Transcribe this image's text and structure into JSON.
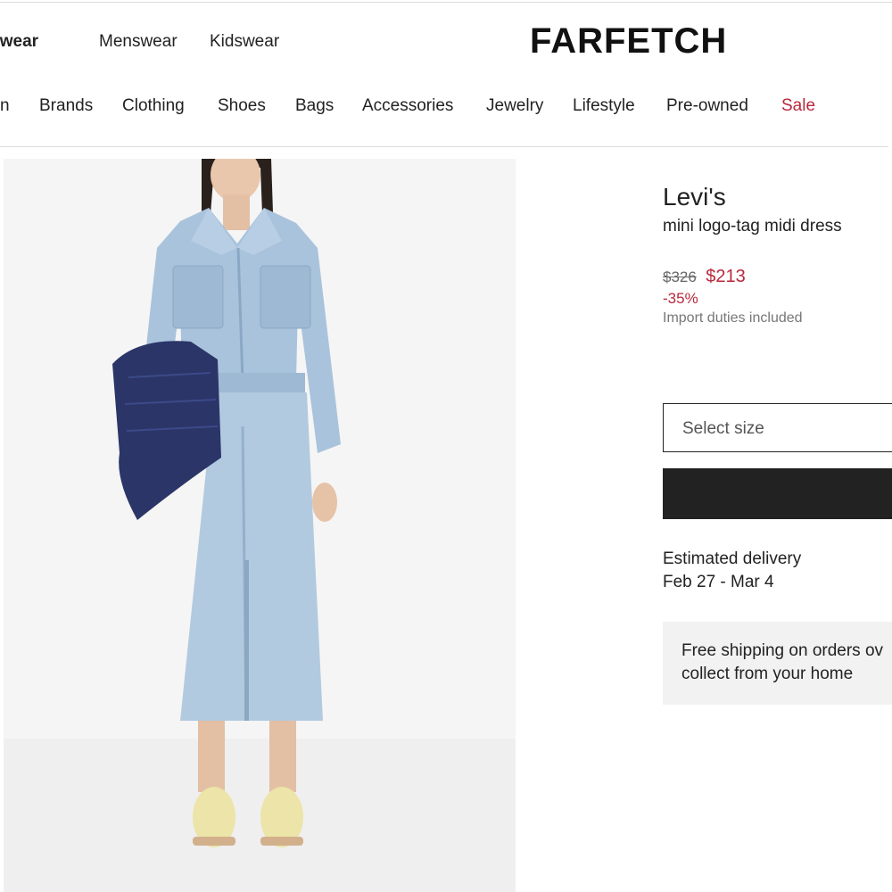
{
  "header": {
    "gender_tabs": [
      "enswear",
      "Menswear",
      "Kidswear"
    ],
    "logo": "FARFETCH"
  },
  "categories": [
    "n",
    "Brands",
    "Clothing",
    "Shoes",
    "Bags",
    "Accessories",
    "Jewelry",
    "Lifestyle",
    "Pre-owned",
    "Sale"
  ],
  "product": {
    "brand": "Levi's",
    "name": "mini logo-tag midi dress",
    "price_original": "$326",
    "price_sale": "$213",
    "discount": "-35%",
    "duties_note": "Import duties included",
    "size_placeholder": "Select size",
    "add_to_bag_label": "",
    "delivery_label": "Estimated delivery",
    "delivery_dates": "Feb 27 - Mar 4",
    "shipping_line1": "Free shipping on orders ov",
    "shipping_line2": "collect from your home"
  },
  "colors": {
    "sale": "#b8283c",
    "button": "#222222",
    "image_bg": "#f5f5f5",
    "denim": "#a9c3dc"
  }
}
